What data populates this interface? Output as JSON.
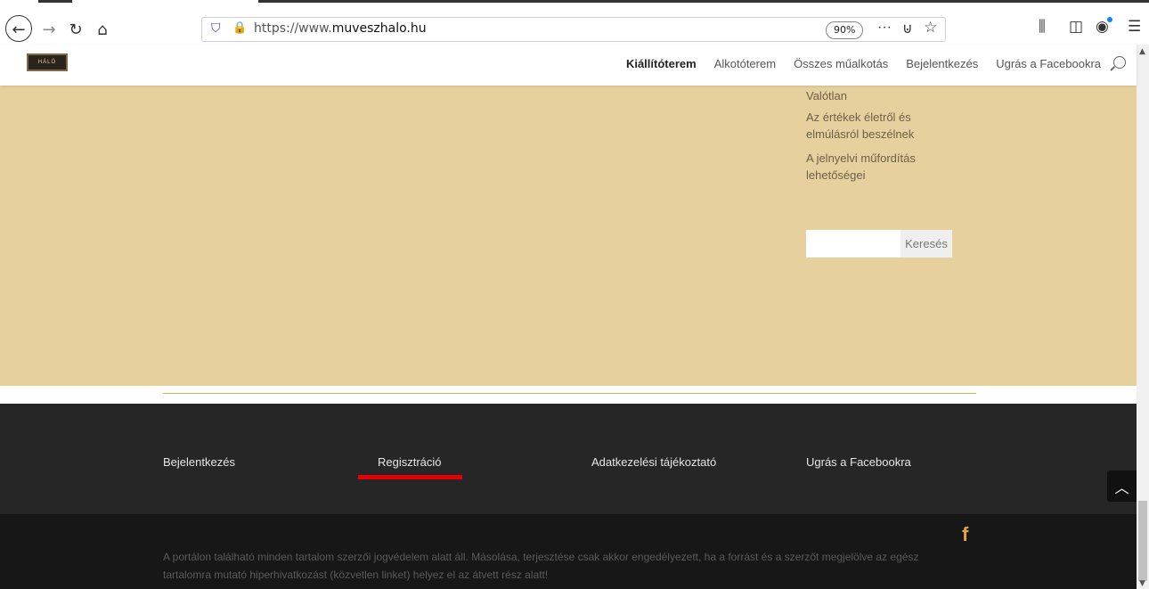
{
  "browser": {
    "url_prefix": "https://www.",
    "url_domain": "muveszhalo.hu",
    "zoom": "90%",
    "icons": [
      "back-icon",
      "forward-icon",
      "reload-icon",
      "home-icon",
      "shield-icon",
      "lock-icon",
      "more-icon",
      "pocket-icon",
      "bookmark-star-icon",
      "library-icon",
      "sidebar-icon",
      "account-icon",
      "menu-icon"
    ]
  },
  "site": {
    "logo_text": "HÁLÓ",
    "menu": [
      "Kiállítóterem",
      "Alkotóterem",
      "Összes műalkotás",
      "Bejelentkezés",
      "Ugrás a Facebookra"
    ]
  },
  "content": {
    "widget_links": [
      "Valótlan",
      "Az értékek életről és elmúlásról beszélnek",
      "A jelnyelvi műfordítás lehetőségei"
    ],
    "search_button": "Keresés",
    "search_placeholder": ""
  },
  "footer": {
    "links": [
      "Bejelentkezés",
      "Regisztráció",
      "Adatkezelési tájékoztató",
      "Ugrás a Facebookra"
    ],
    "facebook_icon": "f",
    "copyright": "A portálon található minden tartalom szerzői jogvédelem alatt áll. Másolása, terjesztése csak akkor engedélyezett, ha a forrást és a szerzőt megjelölve az egész tartalomra mutató hiperhivatkozást (közvetlen linket) helyez el az átvett rész alatt!",
    "scroll_top_icon": "^"
  },
  "colors": {
    "content_bg": "#e6d19e",
    "footer_bg": "#262626",
    "footer_bottom_bg": "#171717",
    "accent_gold": "#d6b24e",
    "facebook_orange": "#e4a23c",
    "highlight_red": "#e30000"
  }
}
